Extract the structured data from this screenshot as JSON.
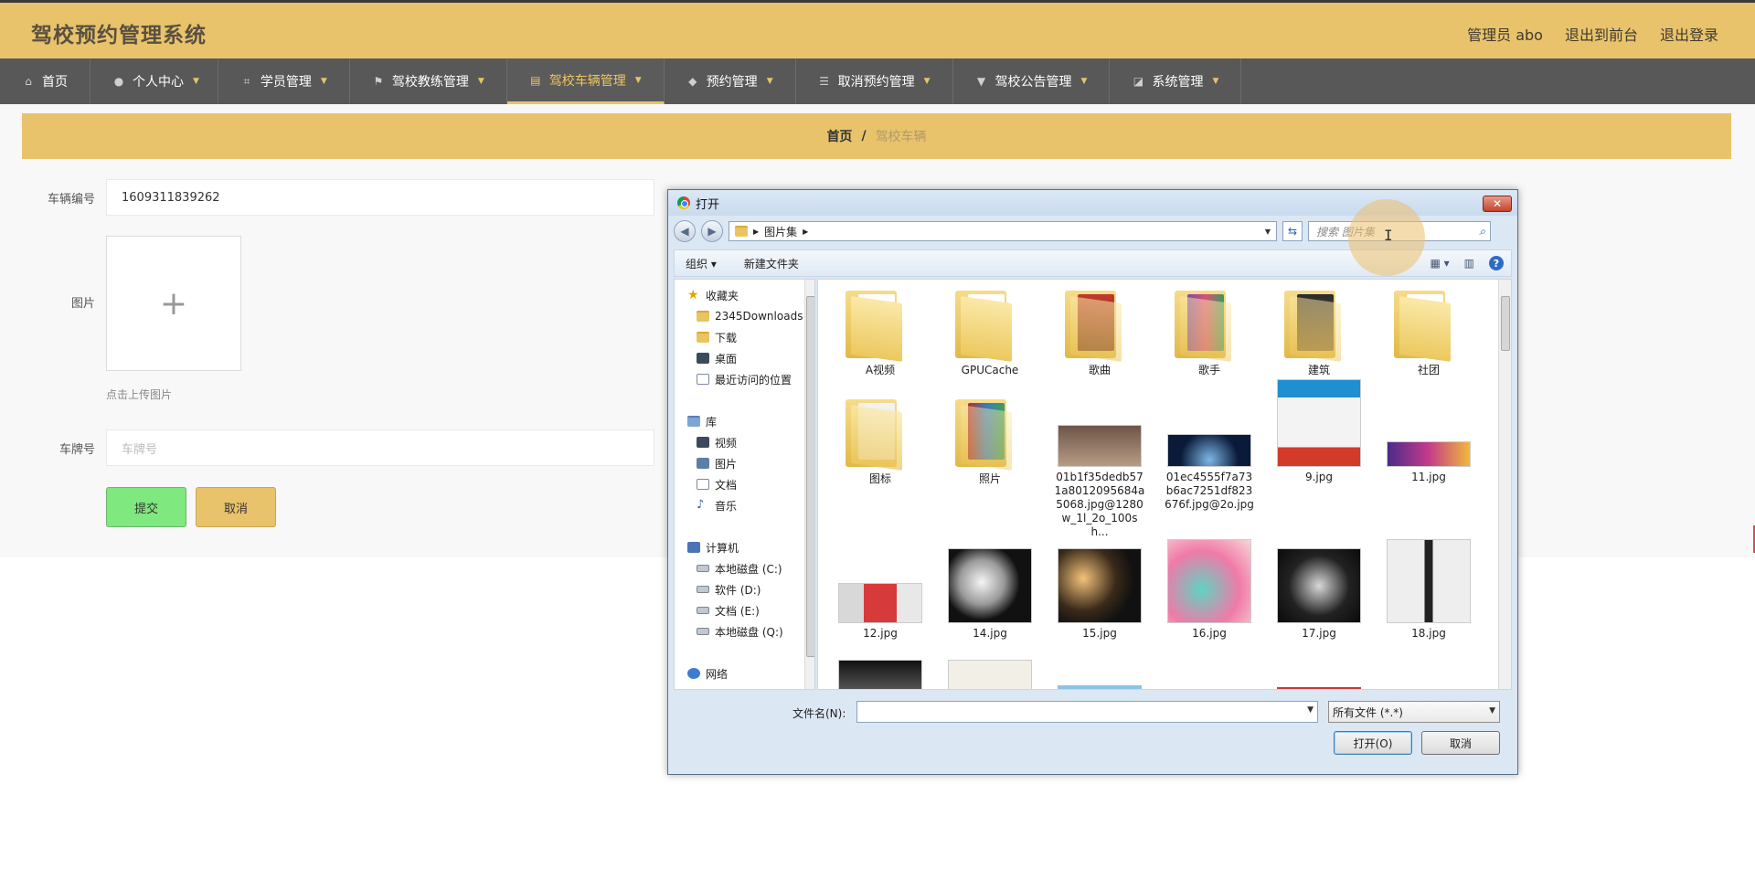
{
  "app": {
    "title": "驾校预约管理系统",
    "user_label": "管理员 abo",
    "front_link": "退出到前台",
    "logout_link": "退出登录"
  },
  "nav": [
    {
      "label": "首页",
      "icon": "home-icon"
    },
    {
      "label": "个人中心",
      "icon": "user-icon"
    },
    {
      "label": "学员管理",
      "icon": "frame-icon"
    },
    {
      "label": "驾校教练管理",
      "icon": "flag-icon"
    },
    {
      "label": "驾校车辆管理",
      "icon": "clipboard-icon"
    },
    {
      "label": "预约管理",
      "icon": "shield-icon"
    },
    {
      "label": "取消预约管理",
      "icon": "sliders-icon"
    },
    {
      "label": "驾校公告管理",
      "icon": "pushpin-icon"
    },
    {
      "label": "系统管理",
      "icon": "chart-icon"
    }
  ],
  "breadcrumb": {
    "home": "首页",
    "separator": "/",
    "current": "驾校车辆"
  },
  "form": {
    "vehicle_no_label": "车辆编号",
    "vehicle_no_value": "1609311839262",
    "image_label": "图片",
    "upload_hint": "点击上传图片",
    "plate_label": "车牌号",
    "plate_placeholder": "车牌号",
    "submit_label": "提交",
    "cancel_label": "取消"
  },
  "dialog": {
    "title": "打开",
    "close_label": "✕",
    "path": "图片集",
    "search_placeholder": "搜索 图片集",
    "toolbar_organize": "组织",
    "toolbar_new_folder": "新建文件夹",
    "tree": [
      {
        "label": "收藏夹",
        "icon": "star-icon"
      },
      {
        "label": "2345Downloads",
        "icon": "folder-icon"
      },
      {
        "label": "下载",
        "icon": "folder-icon"
      },
      {
        "label": "桌面",
        "icon": "desktop-icon"
      },
      {
        "label": "最近访问的位置",
        "icon": "recent-icon"
      },
      {
        "label": "库",
        "icon": "library-icon"
      },
      {
        "label": "视频",
        "icon": "video-icon"
      },
      {
        "label": "图片",
        "icon": "picture-icon"
      },
      {
        "label": "文档",
        "icon": "document-icon"
      },
      {
        "label": "音乐",
        "icon": "music-icon"
      },
      {
        "label": "计算机",
        "icon": "computer-icon"
      },
      {
        "label": "本地磁盘 (C:)",
        "icon": "drive-icon"
      },
      {
        "label": "软件 (D:)",
        "icon": "drive-icon"
      },
      {
        "label": "文档 (E:)",
        "icon": "drive-icon"
      },
      {
        "label": "本地磁盘 (Q:)",
        "icon": "drive-icon"
      },
      {
        "label": "网络",
        "icon": "network-icon"
      }
    ],
    "files": [
      {
        "name": "A视频",
        "kind": "folder"
      },
      {
        "name": "GPUCache",
        "kind": "folder"
      },
      {
        "name": "歌曲",
        "kind": "folder"
      },
      {
        "name": "歌手",
        "kind": "folder"
      },
      {
        "name": "建筑",
        "kind": "folder"
      },
      {
        "name": "社团",
        "kind": "folder"
      },
      {
        "name": "图标",
        "kind": "folder"
      },
      {
        "name": "照片",
        "kind": "folder"
      },
      {
        "name": "01b1f35dedb571a8012095684a5068.jpg@1280w_1l_2o_100sh...",
        "kind": "image"
      },
      {
        "name": "01ec4555f7a73b6ac7251df823676f.jpg@2o.jpg",
        "kind": "image"
      },
      {
        "name": "9.jpg",
        "kind": "image"
      },
      {
        "name": "11.jpg",
        "kind": "image"
      },
      {
        "name": "12.jpg",
        "kind": "image"
      },
      {
        "name": "14.jpg",
        "kind": "image"
      },
      {
        "name": "15.jpg",
        "kind": "image"
      },
      {
        "name": "16.jpg",
        "kind": "image"
      },
      {
        "name": "17.jpg",
        "kind": "image"
      },
      {
        "name": "18.jpg",
        "kind": "image"
      }
    ],
    "filename_label": "文件名(N):",
    "filename_value": "",
    "filetype_value": "所有文件 (*.*)",
    "open_label": "打开(O)",
    "cancel_label": "取消"
  }
}
